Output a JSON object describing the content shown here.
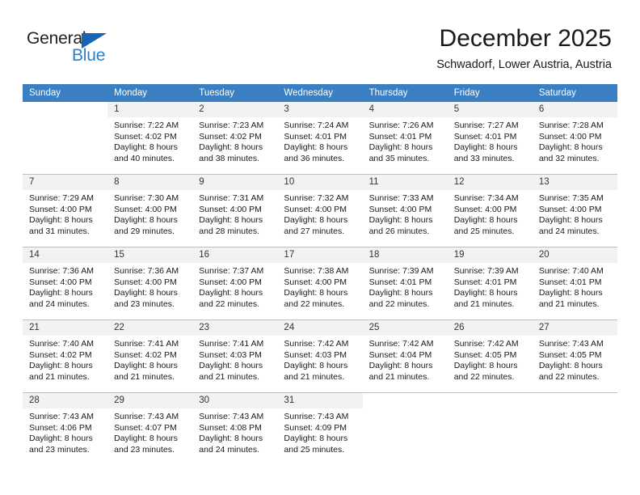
{
  "brand": {
    "name_top": "General",
    "name_bottom": "Blue",
    "triangle_color": "#1665b5",
    "text_color": "#231f20",
    "blue_text_color": "#2a7fc9"
  },
  "header": {
    "title": "December 2025",
    "location": "Schwadorf, Lower Austria, Austria"
  },
  "theme": {
    "header_bg": "#3a7fc1",
    "header_text": "#ffffff",
    "daynum_bg": "#f2f2f2",
    "grid_line": "#bfbfbf"
  },
  "calendar": {
    "weekday_headers": [
      "Sunday",
      "Monday",
      "Tuesday",
      "Wednesday",
      "Thursday",
      "Friday",
      "Saturday"
    ],
    "weeks": [
      [
        {
          "day": "",
          "sunrise": "",
          "sunset": "",
          "daylight_line1": "",
          "daylight_line2": "",
          "blank": true
        },
        {
          "day": "1",
          "sunrise": "Sunrise: 7:22 AM",
          "sunset": "Sunset: 4:02 PM",
          "daylight_line1": "Daylight: 8 hours",
          "daylight_line2": "and 40 minutes."
        },
        {
          "day": "2",
          "sunrise": "Sunrise: 7:23 AM",
          "sunset": "Sunset: 4:02 PM",
          "daylight_line1": "Daylight: 8 hours",
          "daylight_line2": "and 38 minutes."
        },
        {
          "day": "3",
          "sunrise": "Sunrise: 7:24 AM",
          "sunset": "Sunset: 4:01 PM",
          "daylight_line1": "Daylight: 8 hours",
          "daylight_line2": "and 36 minutes."
        },
        {
          "day": "4",
          "sunrise": "Sunrise: 7:26 AM",
          "sunset": "Sunset: 4:01 PM",
          "daylight_line1": "Daylight: 8 hours",
          "daylight_line2": "and 35 minutes."
        },
        {
          "day": "5",
          "sunrise": "Sunrise: 7:27 AM",
          "sunset": "Sunset: 4:01 PM",
          "daylight_line1": "Daylight: 8 hours",
          "daylight_line2": "and 33 minutes."
        },
        {
          "day": "6",
          "sunrise": "Sunrise: 7:28 AM",
          "sunset": "Sunset: 4:00 PM",
          "daylight_line1": "Daylight: 8 hours",
          "daylight_line2": "and 32 minutes."
        }
      ],
      [
        {
          "day": "7",
          "sunrise": "Sunrise: 7:29 AM",
          "sunset": "Sunset: 4:00 PM",
          "daylight_line1": "Daylight: 8 hours",
          "daylight_line2": "and 31 minutes."
        },
        {
          "day": "8",
          "sunrise": "Sunrise: 7:30 AM",
          "sunset": "Sunset: 4:00 PM",
          "daylight_line1": "Daylight: 8 hours",
          "daylight_line2": "and 29 minutes."
        },
        {
          "day": "9",
          "sunrise": "Sunrise: 7:31 AM",
          "sunset": "Sunset: 4:00 PM",
          "daylight_line1": "Daylight: 8 hours",
          "daylight_line2": "and 28 minutes."
        },
        {
          "day": "10",
          "sunrise": "Sunrise: 7:32 AM",
          "sunset": "Sunset: 4:00 PM",
          "daylight_line1": "Daylight: 8 hours",
          "daylight_line2": "and 27 minutes."
        },
        {
          "day": "11",
          "sunrise": "Sunrise: 7:33 AM",
          "sunset": "Sunset: 4:00 PM",
          "daylight_line1": "Daylight: 8 hours",
          "daylight_line2": "and 26 minutes."
        },
        {
          "day": "12",
          "sunrise": "Sunrise: 7:34 AM",
          "sunset": "Sunset: 4:00 PM",
          "daylight_line1": "Daylight: 8 hours",
          "daylight_line2": "and 25 minutes."
        },
        {
          "day": "13",
          "sunrise": "Sunrise: 7:35 AM",
          "sunset": "Sunset: 4:00 PM",
          "daylight_line1": "Daylight: 8 hours",
          "daylight_line2": "and 24 minutes."
        }
      ],
      [
        {
          "day": "14",
          "sunrise": "Sunrise: 7:36 AM",
          "sunset": "Sunset: 4:00 PM",
          "daylight_line1": "Daylight: 8 hours",
          "daylight_line2": "and 24 minutes."
        },
        {
          "day": "15",
          "sunrise": "Sunrise: 7:36 AM",
          "sunset": "Sunset: 4:00 PM",
          "daylight_line1": "Daylight: 8 hours",
          "daylight_line2": "and 23 minutes."
        },
        {
          "day": "16",
          "sunrise": "Sunrise: 7:37 AM",
          "sunset": "Sunset: 4:00 PM",
          "daylight_line1": "Daylight: 8 hours",
          "daylight_line2": "and 22 minutes."
        },
        {
          "day": "17",
          "sunrise": "Sunrise: 7:38 AM",
          "sunset": "Sunset: 4:00 PM",
          "daylight_line1": "Daylight: 8 hours",
          "daylight_line2": "and 22 minutes."
        },
        {
          "day": "18",
          "sunrise": "Sunrise: 7:39 AM",
          "sunset": "Sunset: 4:01 PM",
          "daylight_line1": "Daylight: 8 hours",
          "daylight_line2": "and 22 minutes."
        },
        {
          "day": "19",
          "sunrise": "Sunrise: 7:39 AM",
          "sunset": "Sunset: 4:01 PM",
          "daylight_line1": "Daylight: 8 hours",
          "daylight_line2": "and 21 minutes."
        },
        {
          "day": "20",
          "sunrise": "Sunrise: 7:40 AM",
          "sunset": "Sunset: 4:01 PM",
          "daylight_line1": "Daylight: 8 hours",
          "daylight_line2": "and 21 minutes."
        }
      ],
      [
        {
          "day": "21",
          "sunrise": "Sunrise: 7:40 AM",
          "sunset": "Sunset: 4:02 PM",
          "daylight_line1": "Daylight: 8 hours",
          "daylight_line2": "and 21 minutes."
        },
        {
          "day": "22",
          "sunrise": "Sunrise: 7:41 AM",
          "sunset": "Sunset: 4:02 PM",
          "daylight_line1": "Daylight: 8 hours",
          "daylight_line2": "and 21 minutes."
        },
        {
          "day": "23",
          "sunrise": "Sunrise: 7:41 AM",
          "sunset": "Sunset: 4:03 PM",
          "daylight_line1": "Daylight: 8 hours",
          "daylight_line2": "and 21 minutes."
        },
        {
          "day": "24",
          "sunrise": "Sunrise: 7:42 AM",
          "sunset": "Sunset: 4:03 PM",
          "daylight_line1": "Daylight: 8 hours",
          "daylight_line2": "and 21 minutes."
        },
        {
          "day": "25",
          "sunrise": "Sunrise: 7:42 AM",
          "sunset": "Sunset: 4:04 PM",
          "daylight_line1": "Daylight: 8 hours",
          "daylight_line2": "and 21 minutes."
        },
        {
          "day": "26",
          "sunrise": "Sunrise: 7:42 AM",
          "sunset": "Sunset: 4:05 PM",
          "daylight_line1": "Daylight: 8 hours",
          "daylight_line2": "and 22 minutes."
        },
        {
          "day": "27",
          "sunrise": "Sunrise: 7:43 AM",
          "sunset": "Sunset: 4:05 PM",
          "daylight_line1": "Daylight: 8 hours",
          "daylight_line2": "and 22 minutes."
        }
      ],
      [
        {
          "day": "28",
          "sunrise": "Sunrise: 7:43 AM",
          "sunset": "Sunset: 4:06 PM",
          "daylight_line1": "Daylight: 8 hours",
          "daylight_line2": "and 23 minutes."
        },
        {
          "day": "29",
          "sunrise": "Sunrise: 7:43 AM",
          "sunset": "Sunset: 4:07 PM",
          "daylight_line1": "Daylight: 8 hours",
          "daylight_line2": "and 23 minutes."
        },
        {
          "day": "30",
          "sunrise": "Sunrise: 7:43 AM",
          "sunset": "Sunset: 4:08 PM",
          "daylight_line1": "Daylight: 8 hours",
          "daylight_line2": "and 24 minutes."
        },
        {
          "day": "31",
          "sunrise": "Sunrise: 7:43 AM",
          "sunset": "Sunset: 4:09 PM",
          "daylight_line1": "Daylight: 8 hours",
          "daylight_line2": "and 25 minutes."
        },
        {
          "day": "",
          "sunrise": "",
          "sunset": "",
          "daylight_line1": "",
          "daylight_line2": "",
          "blank": true
        },
        {
          "day": "",
          "sunrise": "",
          "sunset": "",
          "daylight_line1": "",
          "daylight_line2": "",
          "blank": true
        },
        {
          "day": "",
          "sunrise": "",
          "sunset": "",
          "daylight_line1": "",
          "daylight_line2": "",
          "blank": true
        }
      ]
    ]
  }
}
